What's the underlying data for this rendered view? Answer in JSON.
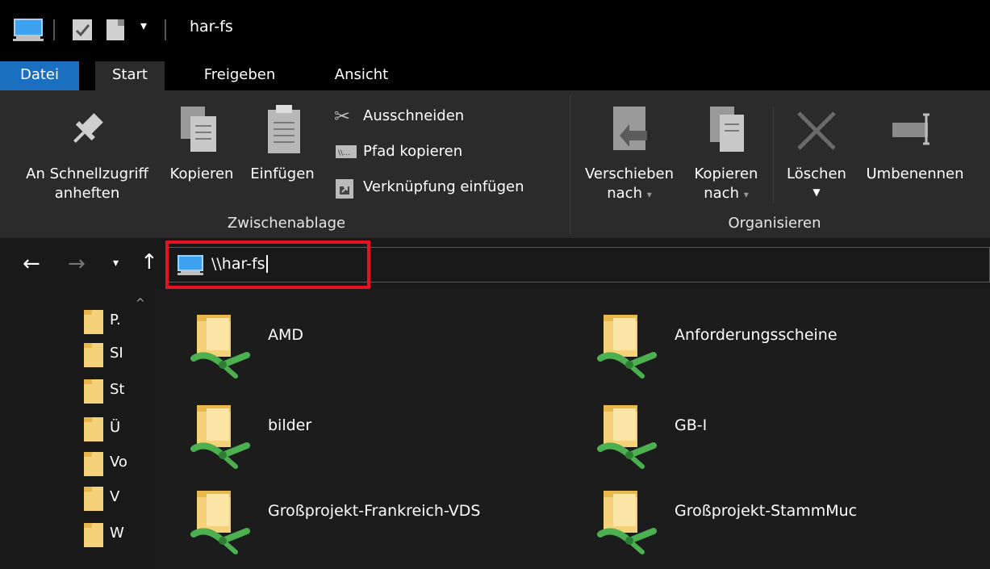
{
  "window": {
    "title": "har-fs"
  },
  "tabs": [
    {
      "label": "Datei"
    },
    {
      "label": "Start"
    },
    {
      "label": "Freigeben"
    },
    {
      "label": "Ansicht"
    }
  ],
  "ribbon": {
    "pin": {
      "line1": "An Schnellzugriff",
      "line2": "anheften"
    },
    "copy": "Kopieren",
    "paste": "Einfügen",
    "cut": "Ausschneiden",
    "copy_path": "Pfad kopieren",
    "paste_shortcut": "Verknüpfung einfügen",
    "group_clipboard": "Zwischenablage",
    "move_to": {
      "line1": "Verschieben",
      "line2": "nach"
    },
    "copy_to": {
      "line1": "Kopieren",
      "line2": "nach"
    },
    "delete": "Löschen",
    "rename": "Umbenennen",
    "group_organize": "Organisieren"
  },
  "address": {
    "path": "\\\\har-fs"
  },
  "sidebar": {
    "items": [
      "P.",
      "SI",
      "St",
      "Ü",
      "Vo",
      "V",
      "W"
    ]
  },
  "content": {
    "items": [
      "AMD",
      "Anforderungsscheine",
      "bilder",
      "GB-I",
      "Großprojekt-Frankreich-VDS",
      "Großprojekt-StammMuc"
    ]
  },
  "colors": {
    "accent_tab": "#1a6fc1",
    "highlight": "#e81123",
    "folder": "#f5d27a",
    "network": "#4caf50"
  }
}
